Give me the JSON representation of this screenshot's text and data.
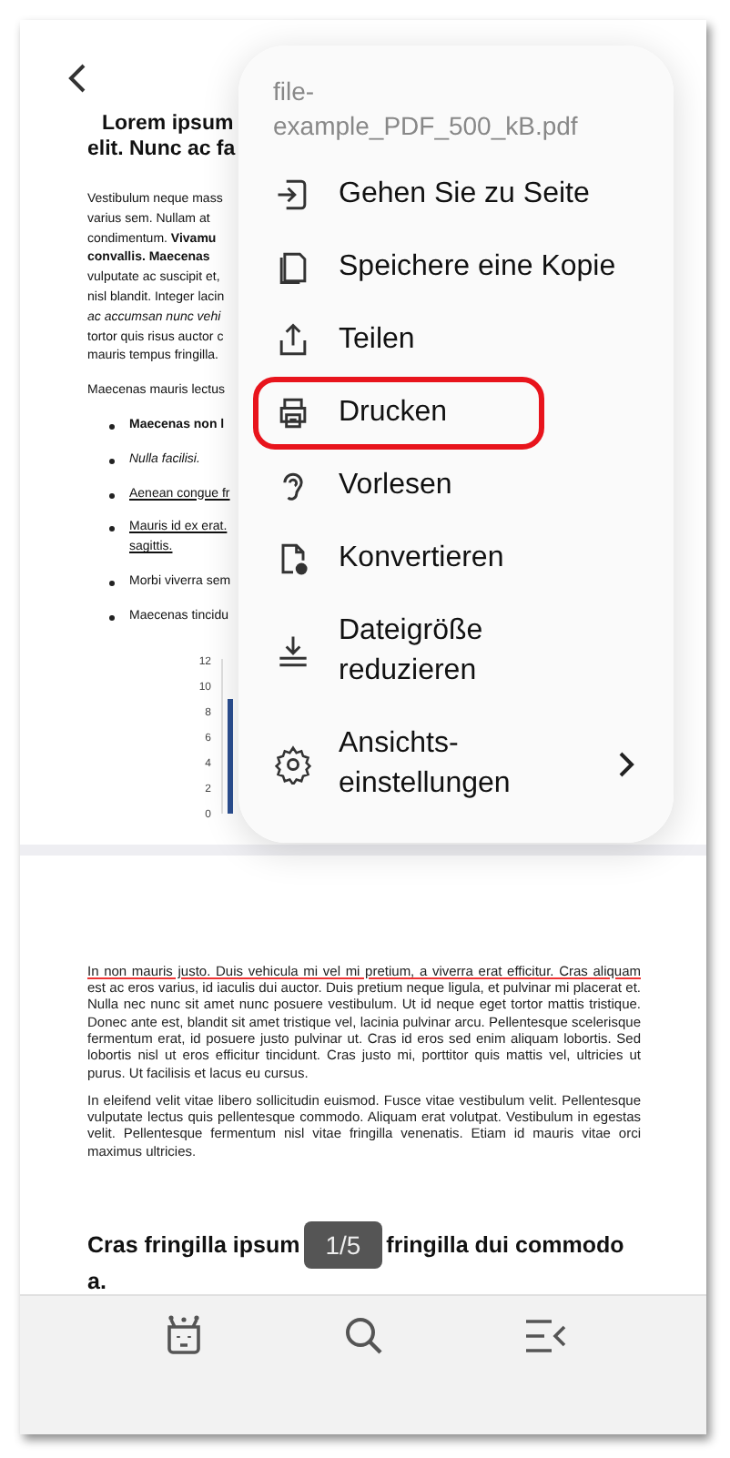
{
  "page_1": {
    "heading": [
      "Lorem ipsum",
      "elit. Nunc ac fa"
    ],
    "paragraph_lines": [
      {
        "text": "Vestibulum neque mass",
        "kind": "plain"
      },
      {
        "text": "varius sem. Nullam at",
        "kind": "plain"
      },
      {
        "text": "condimentum. **Vivamu**",
        "kind": "plain"
      },
      {
        "text": "convallis. Maecenas",
        "kind": "bold"
      },
      {
        "text": "vulputate ac suscipit et,",
        "kind": "plain"
      },
      {
        "text": "nisl blandit. Integer lacin",
        "kind": "plain"
      },
      {
        "text": "ac accumsan nunc vehi",
        "kind": "italic"
      },
      {
        "text": "tortor quis risus auctor c",
        "kind": "plain"
      },
      {
        "text": "mauris tempus fringilla.",
        "kind": "plain"
      }
    ],
    "paragraph_2": "Maecenas mauris lectus",
    "bullets": [
      {
        "lines": [
          "Maecenas non l"
        ],
        "kind": "bold"
      },
      {
        "lines": [
          "Nulla facilisi."
        ],
        "kind": "italic"
      },
      {
        "lines": [
          "Aenean congue fr"
        ],
        "kind": "underline"
      },
      {
        "lines": [
          "Mauris id ex erat.",
          "sagittis."
        ],
        "kind": "underline"
      },
      {
        "lines": [
          "Morbi viverra sem"
        ],
        "kind": "plain"
      },
      {
        "lines": [
          "Maecenas tincidu"
        ],
        "kind": "plain"
      }
    ],
    "chart_data": {
      "type": "bar",
      "ylim": [
        0,
        12
      ],
      "yticks": [
        0,
        2,
        4,
        6,
        8,
        10,
        12
      ],
      "series": [
        {
          "color": "#2b4f91",
          "values": [
            9
          ]
        }
      ]
    }
  },
  "menu": {
    "title": "file-\nexample_PDF_500_kB.pdf",
    "items": [
      {
        "label": "Gehen Sie zu Seite",
        "kind": "action",
        "selected": false
      },
      {
        "label": "Speichere eine Kopie",
        "kind": "action",
        "selected": false
      },
      {
        "label": "Teilen",
        "kind": "action",
        "selected": false
      },
      {
        "label": "Drucken",
        "kind": "action",
        "selected": true
      },
      {
        "label": "Vorlesen",
        "kind": "action",
        "selected": false
      },
      {
        "label": "Konvertieren",
        "kind": "action",
        "selected": false
      },
      {
        "label": "Dateigröße\nreduzieren",
        "kind": "action",
        "selected": false
      },
      {
        "label": "Ansichts-\neinstellungen",
        "kind": "submenu",
        "selected": false
      }
    ]
  },
  "page_2": {
    "paragraphs": [
      {
        "annotated": "In non mauris justo. Duis vehicula mi vel mi pretium, a viverra erat efficitur. Cras aliquam",
        "text": "est ac eros varius, id iaculis dui auctor. Duis pretium neque ligula, et pulvinar mi placerat et. Nulla nec nunc sit amet nunc posuere vestibulum. Ut id neque eget tortor mattis tristique. Donec ante est, blandit sit amet tristique vel, lacinia pulvinar arcu. Pellentesque scelerisque fermentum erat, id posuere justo pulvinar ut. Cras id eros sed enim aliquam lobortis. Sed lobortis nisl ut eros efficitur tincidunt. Cras justo mi, porttitor quis mattis vel, ultricies ut purus. Ut facilisis et lacus eu cursus."
      },
      {
        "text": "In eleifend velit vitae libero sollicitudin euismod. Fusce vitae vestibulum velit. Pellentesque vulputate lectus quis pellentesque commodo. Aliquam erat volutpat. Vestibulum in egestas velit. Pellentesque fermentum nisl vitae fringilla venenatis. Etiam id mauris vitae orci maximus ultricies."
      }
    ],
    "heading_start": "Cras fringilla ipsum",
    "heading_end": "fringilla dui commodo",
    "heading_tail": "a."
  },
  "page_indicator": "1/5"
}
